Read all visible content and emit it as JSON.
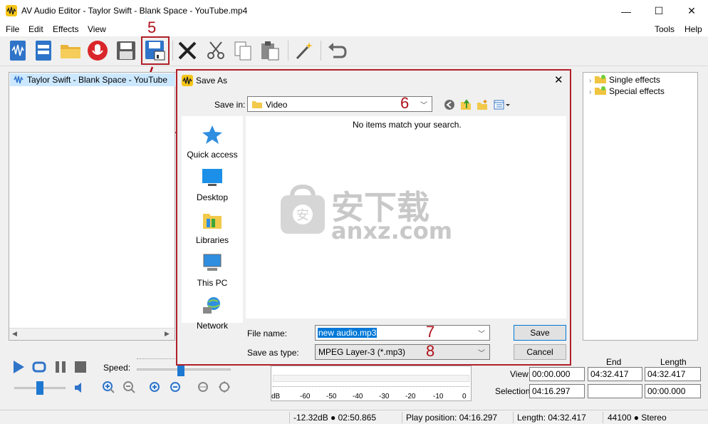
{
  "window": {
    "title": "AV Audio Editor - Taylor Swift - Blank Space - YouTube.mp4",
    "minimize": "—",
    "maximize": "☐",
    "close": "✕"
  },
  "menu": {
    "left": [
      "File",
      "Edit",
      "Effects",
      "View"
    ],
    "right": [
      "Tools",
      "Help"
    ]
  },
  "annotations": {
    "step5": "5",
    "step6": "6",
    "step7": "7",
    "step8": "8"
  },
  "left_panel": {
    "file_item": "Taylor Swift - Blank Space - YouTube"
  },
  "effects_tree": [
    {
      "label": "Single effects"
    },
    {
      "label": "Special effects"
    }
  ],
  "playback": {
    "speed_label": "Speed:"
  },
  "meter": {
    "ticks": [
      "dB",
      "-60",
      "-50",
      "-40",
      "-30",
      "-20",
      "-10",
      "0"
    ]
  },
  "time_grid": {
    "col_end": "End",
    "col_length": "Length",
    "row_view": "View",
    "row_selection": "Selection",
    "view_start": "00:00.000",
    "view_end": "04:32.417",
    "view_length": "04:32.417",
    "sel_start": "04:16.297",
    "sel_end": "",
    "sel_length": "00:00.000"
  },
  "status": {
    "level": "-12.32dB ● 02:50.865",
    "play_position": "Play position: 04:16.297",
    "length": "Length: 04:32.417",
    "format": "44100 ● Stereo"
  },
  "dialog": {
    "title": "Save As",
    "close": "✕",
    "save_in_label": "Save in:",
    "save_in_value": "Video",
    "empty_message": "No items match your search.",
    "places": [
      "Quick access",
      "Desktop",
      "Libraries",
      "This PC",
      "Network"
    ],
    "file_name_label": "File name:",
    "file_name_value": "new audio.mp3",
    "save_type_label": "Save as type:",
    "save_type_value": "MPEG Layer-3 (*.mp3)",
    "save_button": "Save",
    "cancel_button": "Cancel"
  },
  "watermark": {
    "cn": "安下载",
    "latin": "anxz.com"
  },
  "colors": {
    "accent_red": "#b0202a",
    "selection": "#cce8ff",
    "default_button_border": "#0078d7",
    "slider_thumb": "#1e78d2"
  }
}
